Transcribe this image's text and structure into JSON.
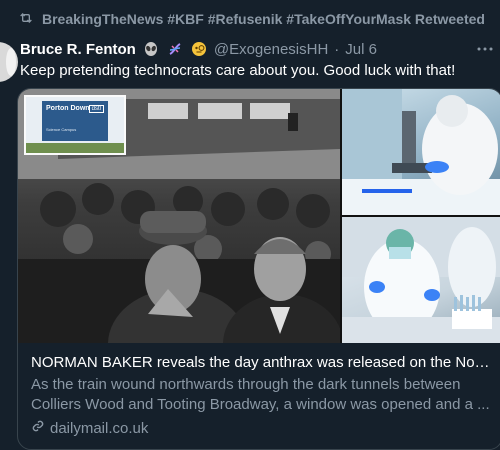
{
  "retweet_banner": {
    "text": "BreakingTheNews #KBF #Refusenik #TakeOffYourMask Retweeted",
    "icon": "retweet-icon"
  },
  "tweet": {
    "author_name": "Bruce R. Fenton",
    "author_emojis": [
      "alien-icon",
      "dna-icon",
      "monocle-face-icon"
    ],
    "handle": "@ExogenesisHH",
    "separator": "·",
    "date": "Jul 6",
    "text": "Keep pretending technocrats care about you. Good luck with that!"
  },
  "link_card": {
    "sign_title": "Porton Down",
    "sign_subtitle": "Science Campus",
    "sign_logo": "dstl",
    "title": "NORMAN BAKER reveals the day anthrax was released on the North...",
    "description": "As the train wound northwards through the dark tunnels between Colliers Wood and Tooting Broadway, a window was opened and a ...",
    "domain": "dailymail.co.uk",
    "domain_icon": "link-icon"
  },
  "colors": {
    "background": "#15202b",
    "secondary_text": "#8b98a5",
    "border": "#38444d"
  }
}
